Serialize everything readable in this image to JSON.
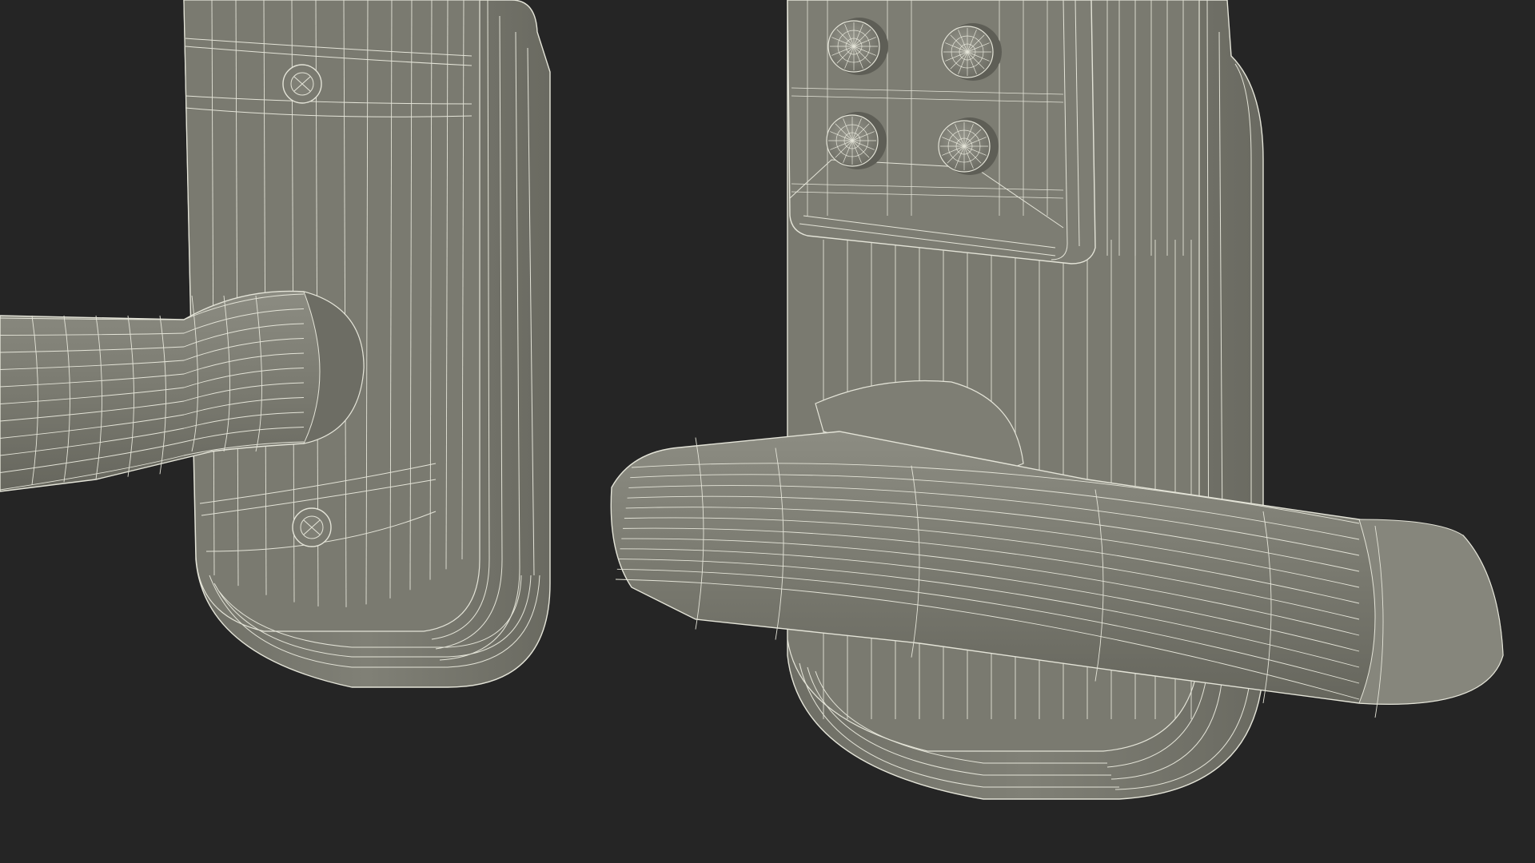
{
  "scene": {
    "description_visible_text": "",
    "colors": {
      "background": "#252525",
      "surface": "#7a7a70",
      "surface_dark": "#68685f",
      "surface_light": "#8a8a80",
      "wire": "#e4e4d8",
      "shadow": "#55554d"
    },
    "objects": [
      {
        "name": "left-door-lock-with-lever-handle"
      },
      {
        "name": "right-door-lock-with-keypad-and-lever-handle"
      }
    ],
    "keypad": {
      "button_count": 4
    }
  }
}
